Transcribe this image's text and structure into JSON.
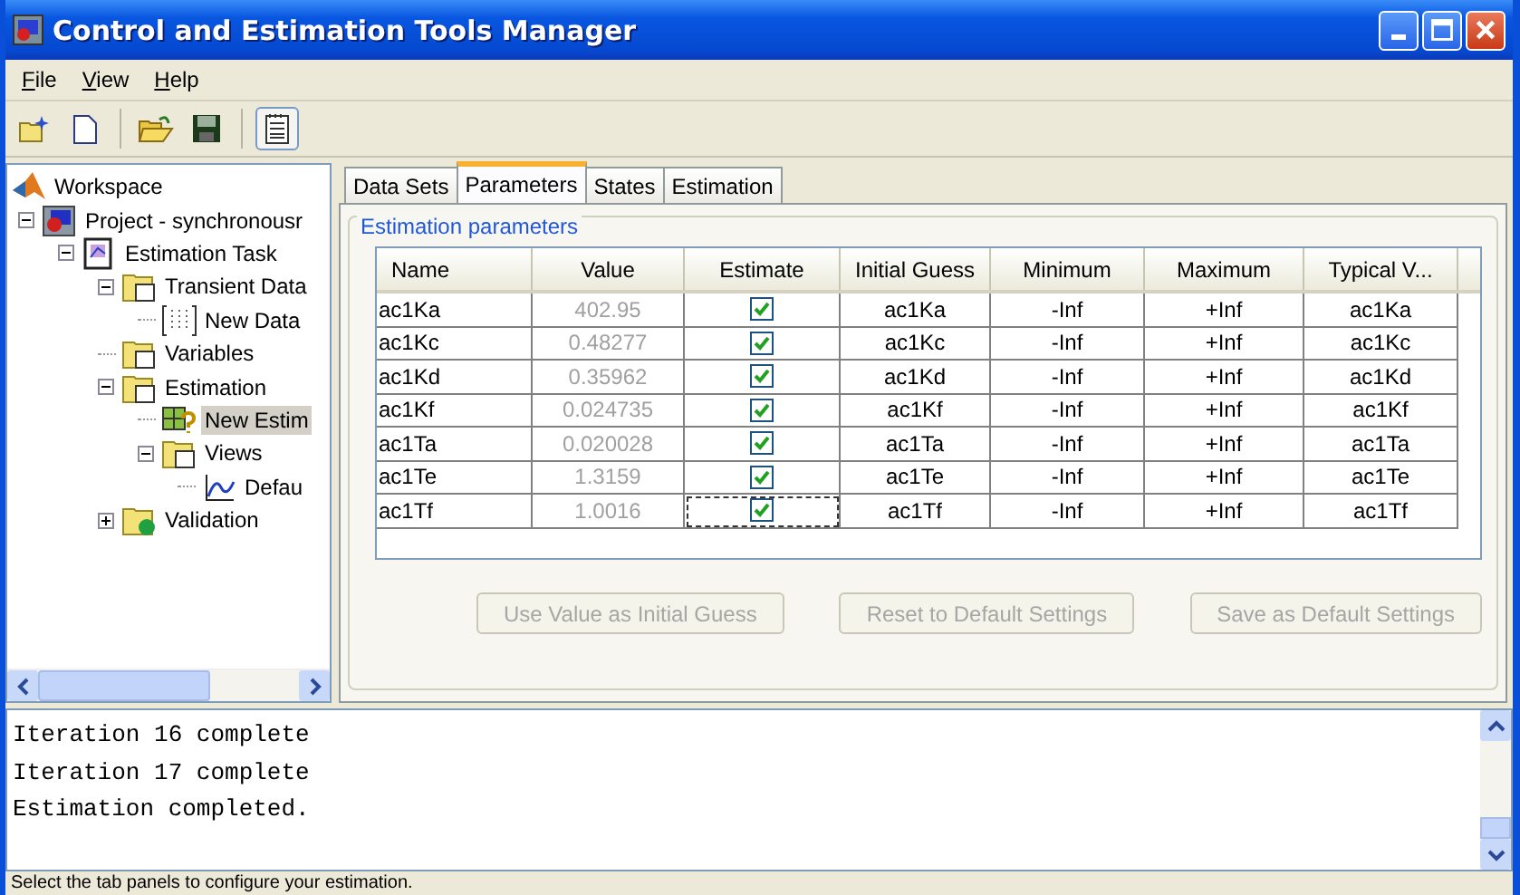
{
  "window": {
    "title": "Control and Estimation Tools Manager"
  },
  "menu": [
    {
      "mnemonic": "F",
      "rest": "ile"
    },
    {
      "mnemonic": "V",
      "rest": "iew"
    },
    {
      "mnemonic": "H",
      "rest": "elp"
    }
  ],
  "tree": [
    {
      "label": "Workspace",
      "kind": "root",
      "selected": false,
      "children": [
        {
          "label": "Project - synchronousr",
          "kind": "project",
          "selected": false,
          "expanded": true,
          "children": [
            {
              "label": "Estimation Task",
              "kind": "task",
              "selected": false,
              "expanded": true,
              "children": [
                {
                  "label": "Transient Data",
                  "kind": "data-folder",
                  "selected": false,
                  "expanded": true,
                  "children": [
                    {
                      "label": "New Data",
                      "kind": "data",
                      "selected": false
                    }
                  ]
                },
                {
                  "label": "Variables",
                  "kind": "variables-folder",
                  "selected": false
                },
                {
                  "label": "Estimation",
                  "kind": "estimation-folder",
                  "selected": false,
                  "expanded": true,
                  "children": [
                    {
                      "label": "New Estim",
                      "kind": "estimation",
                      "selected": true
                    },
                    {
                      "label": "Views",
                      "kind": "views-folder",
                      "selected": false,
                      "expanded": true,
                      "children": [
                        {
                          "label": "Defau",
                          "kind": "view",
                          "selected": false
                        }
                      ]
                    }
                  ]
                },
                {
                  "label": "Validation",
                  "kind": "validation-folder",
                  "selected": false,
                  "expanded": false
                }
              ]
            }
          ]
        }
      ]
    }
  ],
  "tabs": [
    {
      "label": "Data Sets",
      "selected": false
    },
    {
      "label": "Parameters",
      "selected": true
    },
    {
      "label": "States",
      "selected": false
    },
    {
      "label": "Estimation",
      "selected": false
    }
  ],
  "group_title": "Estimation parameters",
  "table": {
    "columns": [
      "Name",
      "Value",
      "Estimate",
      "Initial Guess",
      "Minimum",
      "Maximum",
      "Typical V..."
    ],
    "rows": [
      {
        "name": "ac1Ka",
        "value": "402.95",
        "estimate": true,
        "initial_guess": "ac1Ka",
        "minimum": "-Inf",
        "maximum": "+Inf",
        "typical": "ac1Ka",
        "focused": false
      },
      {
        "name": "ac1Kc",
        "value": "0.48277",
        "estimate": true,
        "initial_guess": "ac1Kc",
        "minimum": "-Inf",
        "maximum": "+Inf",
        "typical": "ac1Kc",
        "focused": false
      },
      {
        "name": "ac1Kd",
        "value": "0.35962",
        "estimate": true,
        "initial_guess": "ac1Kd",
        "minimum": "-Inf",
        "maximum": "+Inf",
        "typical": "ac1Kd",
        "focused": false
      },
      {
        "name": "ac1Kf",
        "value": "0.024735",
        "estimate": true,
        "initial_guess": "ac1Kf",
        "minimum": "-Inf",
        "maximum": "+Inf",
        "typical": "ac1Kf",
        "focused": false
      },
      {
        "name": "ac1Ta",
        "value": "0.020028",
        "estimate": true,
        "initial_guess": "ac1Ta",
        "minimum": "-Inf",
        "maximum": "+Inf",
        "typical": "ac1Ta",
        "focused": false
      },
      {
        "name": "ac1Te",
        "value": "1.3159",
        "estimate": true,
        "initial_guess": "ac1Te",
        "minimum": "-Inf",
        "maximum": "+Inf",
        "typical": "ac1Te",
        "focused": false
      },
      {
        "name": "ac1Tf",
        "value": "1.0016",
        "estimate": true,
        "initial_guess": "ac1Tf",
        "minimum": "-Inf",
        "maximum": "+Inf",
        "typical": "ac1Tf",
        "focused": true
      }
    ]
  },
  "buttons": [
    {
      "label": "Use Value as Initial Guess",
      "disabled": true
    },
    {
      "label": "Reset to Default Settings",
      "disabled": true
    },
    {
      "label": "Save as Default Settings",
      "disabled": true
    }
  ],
  "console": [
    "Iteration 16 complete",
    "Iteration 17 complete",
    "Estimation completed."
  ],
  "status_bar": "Select the tab panels to configure your estimation."
}
